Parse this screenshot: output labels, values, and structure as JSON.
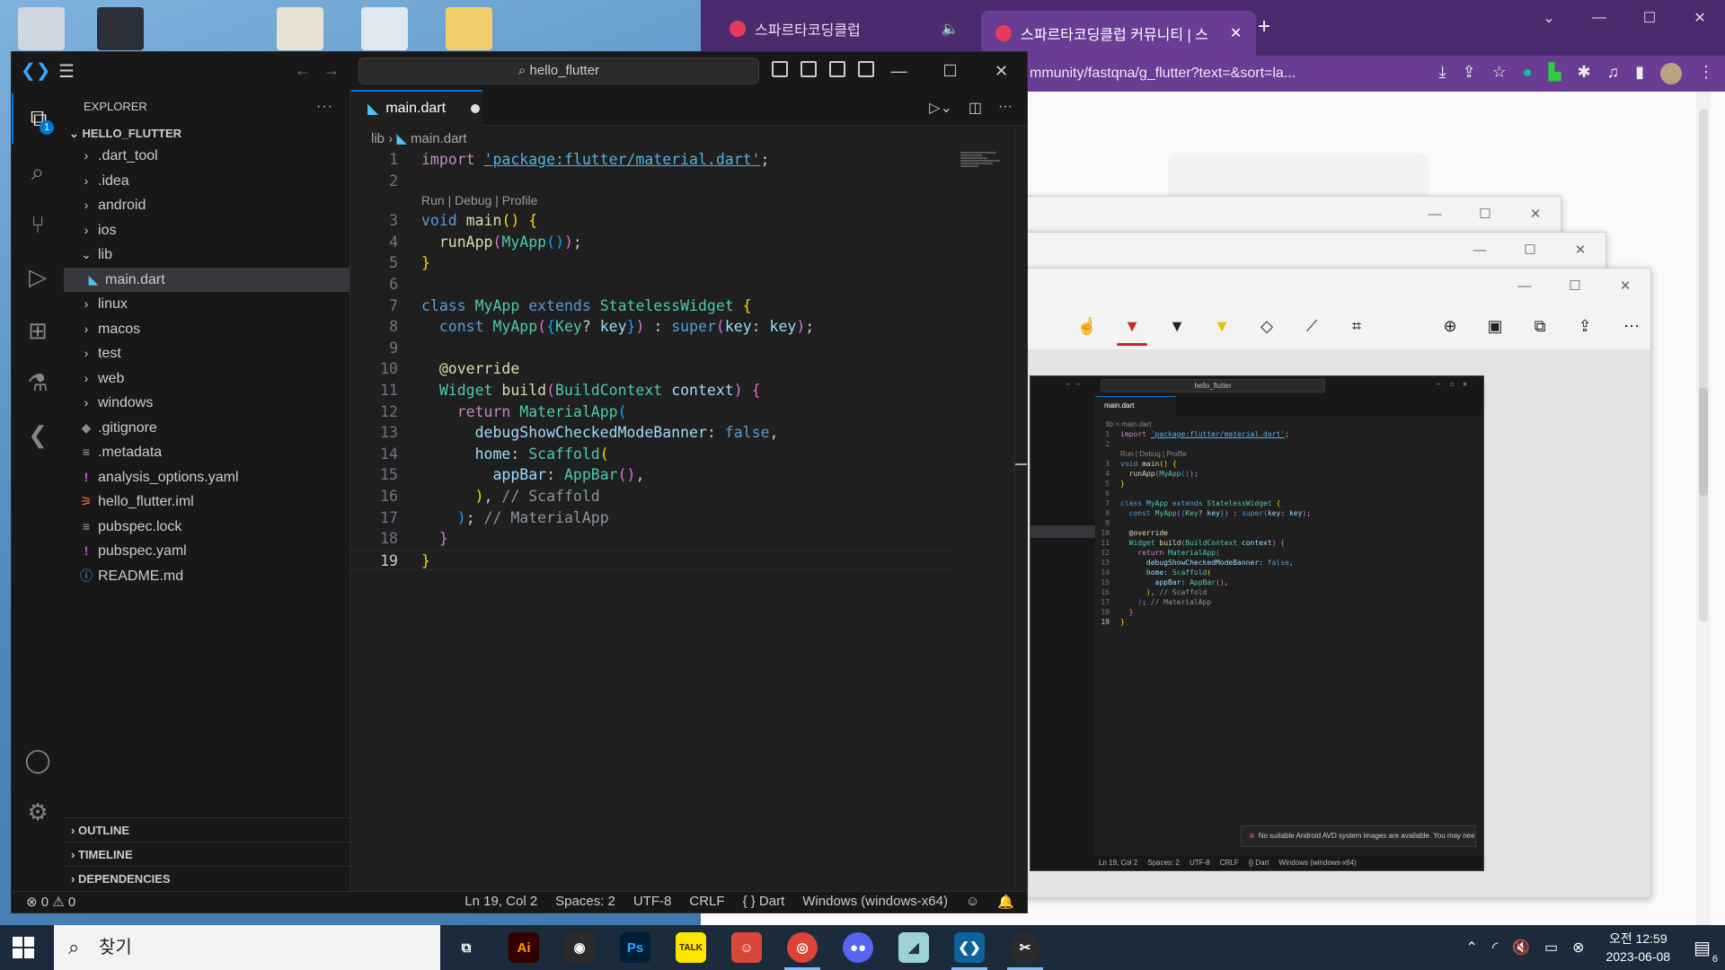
{
  "browser": {
    "tabs": [
      {
        "label": "스파르타코딩클럽"
      },
      {
        "label": "스파르타코딩클럽 커뮤니티 | 스"
      }
    ],
    "url": "mmunity/fastqna/g_flutter?text=&sort=la..."
  },
  "vscode": {
    "search": "hello_flutter",
    "explorer_title": "EXPLORER",
    "project": "HELLO_FLUTTER",
    "tree": [
      {
        "label": ".dart_tool",
        "icon": "chevron-right-icon",
        "indent": 0
      },
      {
        "label": ".idea",
        "icon": "chevron-right-icon",
        "indent": 0
      },
      {
        "label": "android",
        "icon": "chevron-right-icon",
        "indent": 0
      },
      {
        "label": "ios",
        "icon": "chevron-right-icon",
        "indent": 0
      },
      {
        "label": "lib",
        "icon": "chevron-down-icon",
        "indent": 0
      },
      {
        "label": "main.dart",
        "icon": "dart-file-icon",
        "indent": 1,
        "selected": true
      },
      {
        "label": "linux",
        "icon": "chevron-right-icon",
        "indent": 0
      },
      {
        "label": "macos",
        "icon": "chevron-right-icon",
        "indent": 0
      },
      {
        "label": "test",
        "icon": "chevron-right-icon",
        "indent": 0
      },
      {
        "label": "web",
        "icon": "chevron-right-icon",
        "indent": 0
      },
      {
        "label": "windows",
        "icon": "chevron-right-icon",
        "indent": 0
      },
      {
        "label": ".gitignore",
        "icon": "git-file-icon",
        "indent": 0
      },
      {
        "label": ".metadata",
        "icon": "lines-file-icon",
        "indent": 0
      },
      {
        "label": "analysis_options.yaml",
        "icon": "yaml-file-icon",
        "indent": 0
      },
      {
        "label": "hello_flutter.iml",
        "icon": "rss-file-icon",
        "indent": 0
      },
      {
        "label": "pubspec.lock",
        "icon": "lines-file-icon",
        "indent": 0
      },
      {
        "label": "pubspec.yaml",
        "icon": "yaml-file-icon",
        "indent": 0
      },
      {
        "label": "README.md",
        "icon": "info-file-icon",
        "indent": 0
      }
    ],
    "sections": {
      "outline": "OUTLINE",
      "timeline": "TIMELINE",
      "dependencies": "DEPENDENCIES"
    },
    "tab": {
      "label": "main.dart"
    },
    "breadcrumb": {
      "folder": "lib",
      "file": "main.dart"
    },
    "codelens": "Run | Debug | Profile",
    "current_line": 19,
    "activity_badge": "1",
    "status": {
      "problems": "⊗ 0 ⚠ 0",
      "position": "Ln 19, Col 2",
      "spaces": "Spaces: 2",
      "encoding": "UTF-8",
      "eol": "CRLF",
      "language": "{ } Dart",
      "platform": "Windows (windows-x64)"
    }
  },
  "mini": {
    "search": "hello_flutter",
    "tab": "main.dart",
    "breadcrumb": "lib > main.dart",
    "toast": "No suitable Android AVD system images are available. You may need t...",
    "status": "Ln 19, Col 2     Spaces: 2     UTF-8     CRLF     {} Dart     Windows (windows-x64)"
  },
  "taskbar": {
    "search_placeholder": "찾기",
    "time": "오전 12:59",
    "date": "2023-06-08",
    "notification_count": "6"
  },
  "colors": {
    "accent": "#0078d4",
    "browser": "#6a3d94"
  }
}
